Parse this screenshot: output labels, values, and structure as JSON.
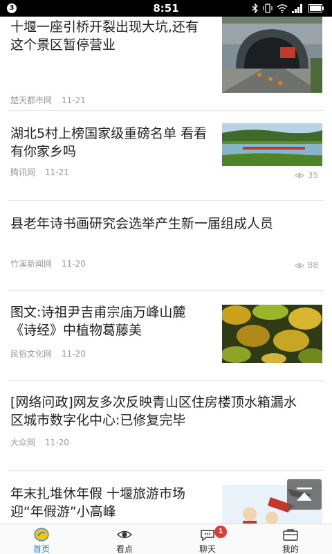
{
  "status_bar": {
    "badge": "3",
    "time": "8:51"
  },
  "colors": {
    "accent": "#2a7fd4",
    "notification": "#e53935",
    "meta_text": "#9a9a9a"
  },
  "feed": [
    {
      "title_line1": "十堰一座引桥开裂出现大坑,还有",
      "title_line2": "这个景区暂停营业",
      "source": "楚天都市网",
      "date": "11-21",
      "views": "",
      "thumb": "tunnel-road-photo"
    },
    {
      "title_line1": "湖北5村上榜国家级重磅名单 看看",
      "title_line2": "有你家乡吗",
      "source": "腾讯网",
      "date": "11-21",
      "views": "35",
      "thumb": "lake-village-photo"
    },
    {
      "title_line1": "县老年诗书画研究会选举产生新一届组成人员",
      "title_line2": "",
      "source": "竹溪新闻网",
      "date": "11-20",
      "views": "88",
      "thumb": ""
    },
    {
      "title_line1": "图文:诗祖尹吉甫宗庙万峰山麓",
      "title_line2": "《诗经》中植物葛藤美",
      "source": "民俗文化网",
      "date": "11-20",
      "views": "",
      "thumb": "autumn-leaves-photo"
    },
    {
      "title_line1": "[网络问政]网友多次反映青山区住房楼顶水箱漏水",
      "title_line2": "区城市数字化中心:已修复完毕",
      "source": "大众网",
      "date": "11-20",
      "views": "",
      "thumb": ""
    },
    {
      "title_line1": "年末扎堆休年假 十堰旅游市场",
      "title_line2": "迎“年假游”小高峰",
      "source": "",
      "date": "",
      "views": "",
      "thumb": "cartoon-travel-illustration"
    }
  ],
  "nav": {
    "tabs": [
      {
        "label": "首页",
        "icon": "home-icon"
      },
      {
        "label": "看点",
        "icon": "eye-icon"
      },
      {
        "label": "聊天",
        "icon": "chat-icon"
      },
      {
        "label": "我的",
        "icon": "briefcase-icon"
      }
    ],
    "chat_badge": "1"
  }
}
